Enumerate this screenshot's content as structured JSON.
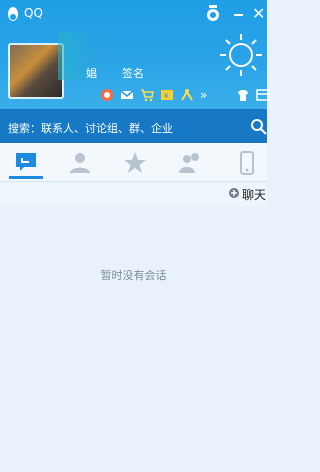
{
  "app": {
    "title": "QQ"
  },
  "profile": {
    "nickname_fragment": "娼",
    "signature_fragment": "签名"
  },
  "search": {
    "placeholder": "搜索：联系人、讨论组、群、企业"
  },
  "actions": {
    "add_chat_label": "聊天"
  },
  "content": {
    "empty_text": "暂时没有会话"
  },
  "colors": {
    "header": "#2ba4e8",
    "searchbar": "#1779c6",
    "background": "#e9f2fb",
    "tab_active": "#1c8be0"
  },
  "icons": {
    "logo": "penguin-icon",
    "weather": "sun-icon",
    "tabs": [
      "chat-icon",
      "contact-icon",
      "star-icon",
      "group-icon",
      "phone-icon"
    ]
  }
}
